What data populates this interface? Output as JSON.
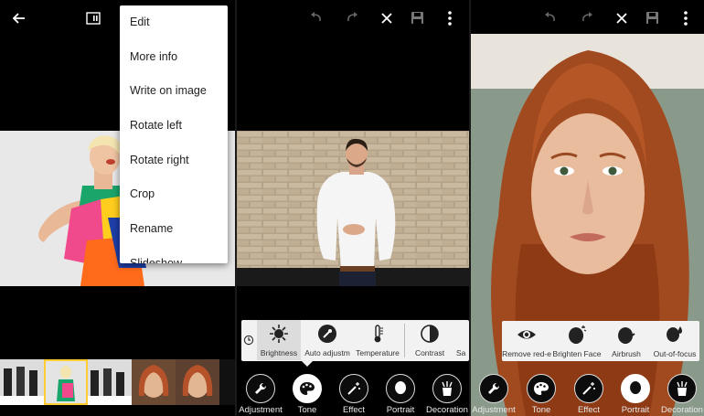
{
  "screen1": {
    "menu": {
      "items": [
        "Edit",
        "More info",
        "Write on image",
        "Rotate left",
        "Rotate right",
        "Crop",
        "Rename",
        "Slideshow"
      ]
    }
  },
  "screen2": {
    "tools": [
      "Brightness",
      "Auto adjustm",
      "Temperature",
      "Contrast",
      "Sa"
    ],
    "tabs": [
      "Adjustment",
      "Tone",
      "Effect",
      "Portrait",
      "Decoration"
    ],
    "active_tab": "Tone"
  },
  "screen3": {
    "tools": [
      "Remove red-e",
      "Brighten Face",
      "Airbrush",
      "Out-of-focus"
    ],
    "tabs": [
      "Adjustment",
      "Tone",
      "Effect",
      "Portrait",
      "Decoration"
    ],
    "active_tab": "Portrait"
  },
  "colors": {
    "background": "#000000",
    "panel": "#f2f2f2",
    "selected_tool": "#dcdcdc",
    "icon": "#ffffff"
  },
  "icons": {
    "screen1_toolbar": [
      "back-arrow-icon",
      "slideshow-icon",
      "more-options-icon"
    ],
    "editor_toolbar": [
      "undo-icon",
      "redo-icon",
      "close-icon",
      "save-icon",
      "more-options-icon"
    ],
    "screen2_tools": [
      "history-icon",
      "brightness-icon",
      "auto-adjust-icon",
      "temperature-icon",
      "contrast-icon"
    ],
    "screen3_tools": [
      "eye-icon",
      "brighten-face-icon",
      "airbrush-icon",
      "out-of-focus-icon"
    ],
    "tabs": [
      "wrench-icon",
      "palette-icon",
      "magic-wand-icon",
      "portrait-icon",
      "decoration-icon"
    ]
  }
}
